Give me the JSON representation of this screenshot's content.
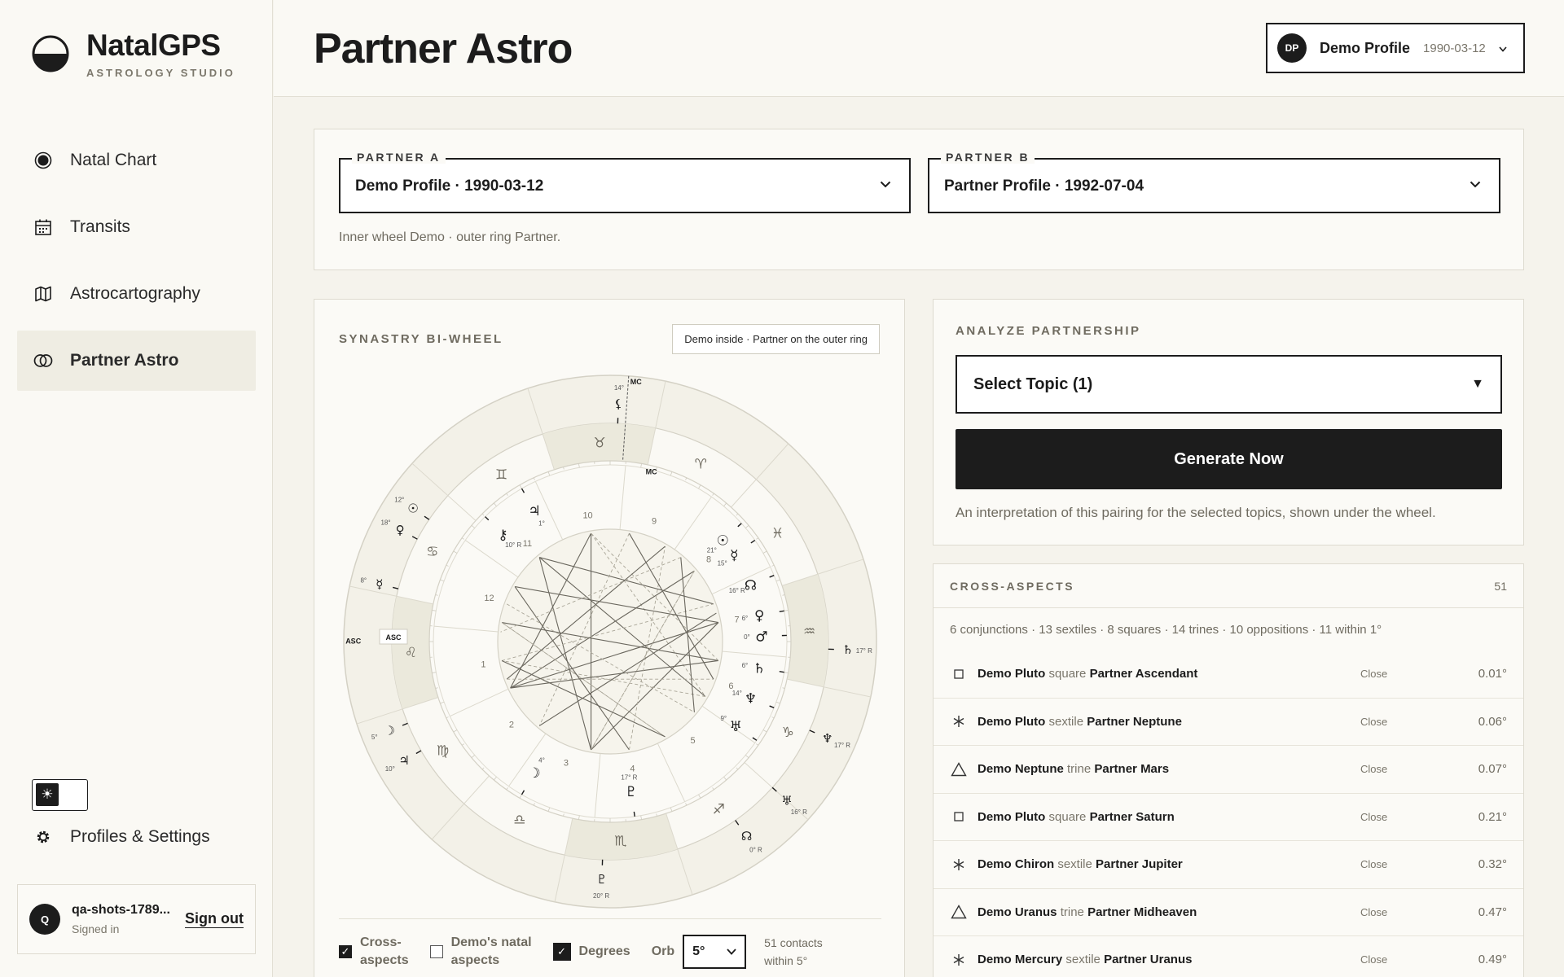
{
  "brand": {
    "name": "NatalGPS",
    "subtitle": "ASTROLOGY STUDIO"
  },
  "nav": [
    {
      "label": "Natal Chart",
      "icon": "target-icon",
      "active": false
    },
    {
      "label": "Transits",
      "icon": "calendar-icon",
      "active": false
    },
    {
      "label": "Astrocartography",
      "icon": "map-icon",
      "active": false
    },
    {
      "label": "Partner Astro",
      "icon": "rings-icon",
      "active": true
    }
  ],
  "theme_toggle": {
    "icon": "sun-icon"
  },
  "settings": {
    "label": "Profiles & Settings",
    "icon": "gear-icon"
  },
  "user": {
    "initial": "Q",
    "name": "qa-shots-1789...",
    "status": "Signed in",
    "signout": "Sign out"
  },
  "header": {
    "title": "Partner Astro",
    "profile": {
      "initials": "DP",
      "name": "Demo Profile",
      "date": "1990-03-12"
    }
  },
  "partners": {
    "a": {
      "label": "PARTNER A",
      "value": "Demo Profile · 1990-03-12"
    },
    "b": {
      "label": "PARTNER B",
      "value": "Partner Profile · 1992-07-04"
    },
    "note": "Inner wheel Demo · outer ring Partner."
  },
  "wheel": {
    "title": "SYNASTRY BI-WHEEL",
    "note": "Demo inside · Partner on the outer ring",
    "zodiac_glyphs": [
      "♉",
      "♈",
      "♓",
      "♒",
      "♑",
      "♐",
      "♏",
      "♎",
      "♍",
      "♌",
      "♋",
      "♊"
    ],
    "house_numbers": [
      "10",
      "9",
      "8",
      "7",
      "6",
      "5",
      "4",
      "3",
      "2",
      "1",
      "12",
      "11"
    ],
    "inner_planets": [
      {
        "glyph": "☉",
        "deg": "21°"
      },
      {
        "glyph": "☿",
        "deg": "15°"
      },
      {
        "glyph": "☊",
        "deg": "16° R"
      },
      {
        "glyph": "♀",
        "deg": "6°"
      },
      {
        "glyph": "♂",
        "deg": "0°"
      },
      {
        "glyph": "♄",
        "deg": "6°"
      },
      {
        "glyph": "♆",
        "deg": "14°"
      },
      {
        "glyph": "♅",
        "deg": "9°"
      },
      {
        "glyph": "♇",
        "deg": "17° R"
      },
      {
        "glyph": "☽",
        "deg": "4°"
      },
      {
        "glyph": "⚷",
        "deg": "10° R"
      },
      {
        "glyph": "♃",
        "deg": "1°"
      }
    ],
    "outer_planets": [
      {
        "glyph": "⚸",
        "deg": "14°"
      },
      {
        "glyph": "☉",
        "deg": "12°"
      },
      {
        "glyph": "♀",
        "deg": "18°"
      },
      {
        "glyph": "☿",
        "deg": "8°"
      },
      {
        "glyph": "☽",
        "deg": "5°"
      },
      {
        "glyph": "♃",
        "deg": "10°"
      },
      {
        "glyph": "♇",
        "deg": "20° R"
      },
      {
        "glyph": "☊",
        "deg": "0° R"
      },
      {
        "glyph": "♅",
        "deg": "16° R"
      },
      {
        "glyph": "♆",
        "deg": "17° R"
      },
      {
        "glyph": "♄",
        "deg": "17° R"
      }
    ],
    "angle_labels": {
      "mc": "MC",
      "asc": "ASC"
    },
    "controls": {
      "cross": {
        "label_line1": "Cross-",
        "label_line2": "aspects",
        "checked": true
      },
      "natal": {
        "label_line1": "Demo's natal",
        "label_line2": "aspects",
        "checked": false
      },
      "degrees": {
        "label": "Degrees",
        "checked": true
      },
      "orb_label": "Orb",
      "orb_value": "5°",
      "contacts_line1": "51 contacts",
      "contacts_line2": "within 5°"
    }
  },
  "analyze": {
    "title": "ANALYZE PARTNERSHIP",
    "select": "Select Topic (1)",
    "button": "Generate Now",
    "note": "An interpretation of this pairing for the selected topics, shown under the wheel."
  },
  "aspects": {
    "title": "CROSS-ASPECTS",
    "count": "51",
    "summary": "6 conjunctions · 13 sextiles · 8 squares · 14 trines · 10 oppositions · 11 within 1°",
    "rows": [
      {
        "type": "square",
        "a": "Demo Pluto",
        "verb": "square",
        "b": "Partner Ascendant",
        "badge": "Close",
        "orb": "0.01°"
      },
      {
        "type": "sextile",
        "a": "Demo Pluto",
        "verb": "sextile",
        "b": "Partner Neptune",
        "badge": "Close",
        "orb": "0.06°"
      },
      {
        "type": "trine",
        "a": "Demo Neptune",
        "verb": "trine",
        "b": "Partner Mars",
        "badge": "Close",
        "orb": "0.07°"
      },
      {
        "type": "square",
        "a": "Demo Pluto",
        "verb": "square",
        "b": "Partner Saturn",
        "badge": "Close",
        "orb": "0.21°"
      },
      {
        "type": "sextile",
        "a": "Demo Chiron",
        "verb": "sextile",
        "b": "Partner Jupiter",
        "badge": "Close",
        "orb": "0.32°"
      },
      {
        "type": "trine",
        "a": "Demo Uranus",
        "verb": "trine",
        "b": "Partner Midheaven",
        "badge": "Close",
        "orb": "0.47°"
      },
      {
        "type": "sextile",
        "a": "Demo Mercury",
        "verb": "sextile",
        "b": "Partner Uranus",
        "badge": "Close",
        "orb": "0.49°"
      }
    ]
  }
}
